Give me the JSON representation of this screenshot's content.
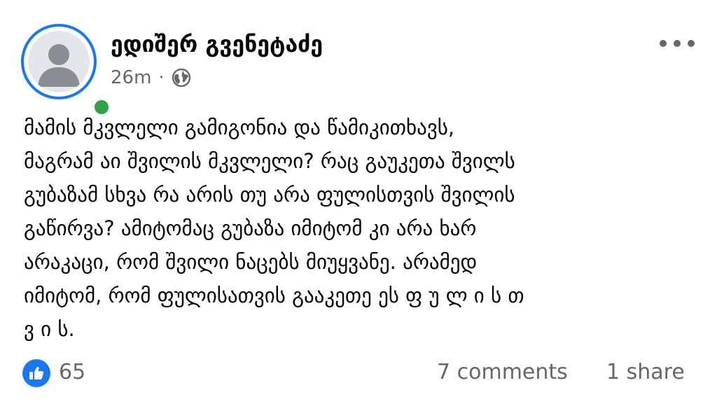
{
  "post": {
    "author_name": "ედიშერ გვენეტაძე",
    "timestamp": "26m",
    "separator": "·",
    "privacy_icon": "globe-icon",
    "text_lines": [
      "მამის მკვლელი გამიგონია და წამიკითხავს,",
      "მაგრამ აი შვილის მკვლელი? რაც გაუკეთა შვილს",
      "გუბაზამ სხვა რა არის თუ არა ფულისთვის შვილის",
      "გაწირვა? ამიტომაც გუბაზა იმიტომ კი არა ხარ",
      "არაკაცი, რომ შვილი ნაცებს მიუყვანე. არამედ",
      "იმიტომ, რომ ფულისათვის გააკეთე ეს ფ უ ლ ი ს თ",
      "ვ ი ს."
    ]
  },
  "reactions": {
    "icon": "like-icon",
    "count": "65"
  },
  "engagement": {
    "comments_label": "7 comments",
    "shares_label": "1 share"
  },
  "colors": {
    "accent": "#1877f2",
    "online": "#31a24c",
    "secondary_text": "#65676b",
    "primary_text": "#050505"
  }
}
